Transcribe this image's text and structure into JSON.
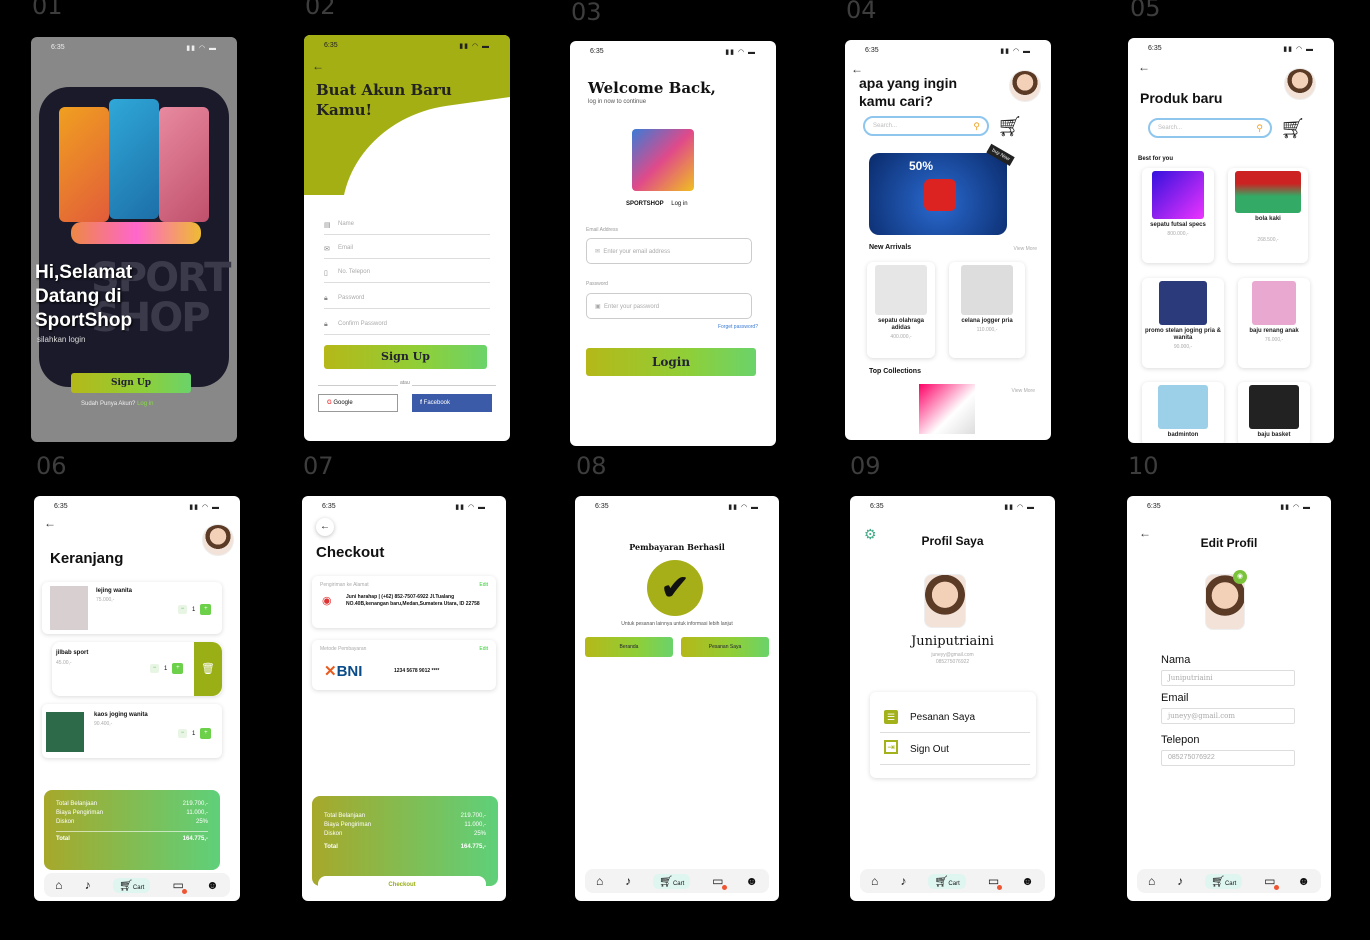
{
  "labels": [
    "01",
    "02",
    "03",
    "04",
    "05",
    "06",
    "07",
    "08",
    "09",
    "10"
  ],
  "time": "6:35",
  "status_icons": "▮▮ ◠ ▬",
  "s1": {
    "greeting": "Hi,Selamat Datang di SportShop",
    "sub": "silahkan login",
    "signup": "Sign Up",
    "have_account": "Sudah Punya Akun?",
    "login_link": "Log in",
    "bg_word1": "SPORT",
    "bg_word2": "SHOP"
  },
  "s2": {
    "title": "Buat Akun Baru Kamu!",
    "fields": [
      "Name",
      "Email",
      "No. Telepon",
      "Password",
      "Confirm Password"
    ],
    "signup": "Sign Up",
    "divider": "atau",
    "google": "Google",
    "facebook": "Facebook"
  },
  "s3": {
    "title": "Welcome Back,",
    "sub": "log in now to continue",
    "brand": "SPORTSHOP",
    "brand_sub": "Log in",
    "email_label": "Email Address",
    "email_placeholder": "Enter your email address",
    "password_label": "Password",
    "password_placeholder": "Enter your password",
    "forgot": "Forget password?",
    "login": "Login"
  },
  "s4": {
    "title": "apa yang ingin kamu cari?",
    "search": "Search...",
    "banner_text": "50%",
    "banner_tag": "buy Now",
    "new_arrivals": "New Arrivals",
    "view_more": "View More",
    "products": [
      {
        "name": "sepatu olahraga adidas",
        "price": "400.000,-"
      },
      {
        "name": "celana jogger pria",
        "price": "110.000,-"
      }
    ],
    "top_collections": "Top Collections",
    "view_more2": "View More"
  },
  "s5": {
    "title": "Produk baru",
    "search": "Search...",
    "best": "Best for you",
    "products": [
      {
        "name": "sepatu futsal specs",
        "price": "800.000,-"
      },
      {
        "name": "bola kaki",
        "price": "268.500,-"
      },
      {
        "name": "promo stelan joging pria & wanita",
        "price": "90.000,-"
      },
      {
        "name": "baju renang anak",
        "price": "76.000,-"
      },
      {
        "name": "badminton",
        "price": ""
      },
      {
        "name": "baju basket",
        "price": ""
      }
    ]
  },
  "s6": {
    "title": "Keranjang",
    "items": [
      {
        "name": "lejing wanita",
        "price": "75.000,-",
        "qty": "1"
      },
      {
        "name": "jilbab sport",
        "price": "45.00,-",
        "qty": "1"
      },
      {
        "name": "kaos joging wanita",
        "price": "90.400,-",
        "qty": "1"
      }
    ],
    "summary": [
      {
        "label": "Total Belanjaan",
        "value": "219.700,-"
      },
      {
        "label": "Biaya Pengiriman",
        "value": "11.000,-"
      },
      {
        "label": "Diskon",
        "value": "25%"
      }
    ],
    "total_label": "Total",
    "total_value": "164.775,-"
  },
  "s7": {
    "title": "Checkout",
    "ship_label": "Pengiriman ke Alamat",
    "edit": "Edit",
    "address": "Juni harahap | (+62) 852-7507-6922 Jl.Tualang NO.40B,kenangan baru,Medan,Sumatera Utara, ID 22758",
    "pay_label": "Metode Pembayaran",
    "edit2": "Edit",
    "bank": "BNI",
    "account": "1234 5678 9012 ****",
    "summary": [
      {
        "label": "Total Belanjaan",
        "value": "219.700,-"
      },
      {
        "label": "Biaya Pengiriman",
        "value": "11.000,-"
      },
      {
        "label": "Diskon",
        "value": "25%"
      }
    ],
    "total_label": "Total",
    "total_value": "164.775,-",
    "checkout": "Checkout"
  },
  "s8": {
    "title": "Pembayaran Berhasil",
    "sub": "Untuk pesanan lainnya untuk informasi lebih lanjut",
    "home": "Beranda",
    "orders": "Pesanan Saya"
  },
  "s9": {
    "title": "Profil Saya",
    "name": "Juniputriaini",
    "email": "juneyy@gmail.com",
    "phone": "085275076922",
    "menu1": "Pesanan Saya",
    "menu2": "Sign Out"
  },
  "s10": {
    "title": "Edit Profil",
    "name_label": "Nama",
    "name_value": "Juniputriaini",
    "email_label": "Email",
    "email_value": "juneyy@gmail.com",
    "phone_label": "Telepon",
    "phone_value": "085275076922"
  },
  "nav": {
    "cart": "Cart"
  },
  "colors": {
    "accent_green": "#a8b514",
    "brand_olive": "#9bae12",
    "fb_blue": "#3b5ba8"
  }
}
